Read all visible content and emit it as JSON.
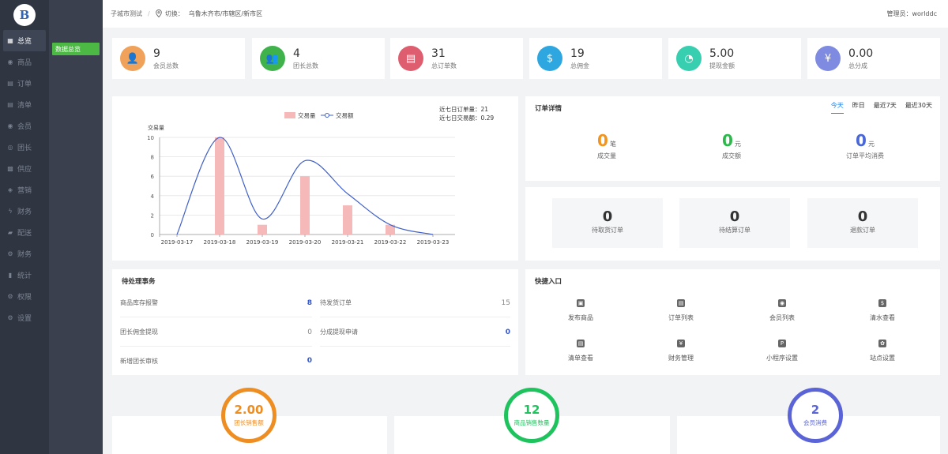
{
  "logo": {
    "letter": "B"
  },
  "sidebar": {
    "items": [
      {
        "label": "总览",
        "icon": "grid-icon",
        "glyph": "▦",
        "active": true
      },
      {
        "label": "商品",
        "icon": "box-icon",
        "glyph": "◉"
      },
      {
        "label": "订单",
        "icon": "document-icon",
        "glyph": "▤"
      },
      {
        "label": "清单",
        "icon": "list-icon",
        "glyph": "▤"
      },
      {
        "label": "会员",
        "icon": "user-icon",
        "glyph": "◉"
      },
      {
        "label": "团长",
        "icon": "group-icon",
        "glyph": "◎"
      },
      {
        "label": "供应",
        "icon": "truck-icon",
        "glyph": "▩"
      },
      {
        "label": "营销",
        "icon": "megaphone-icon",
        "glyph": "◈"
      },
      {
        "label": "财务",
        "icon": "lightning-icon",
        "glyph": "ϟ"
      },
      {
        "label": "配送",
        "icon": "delivery-icon",
        "glyph": "▰"
      },
      {
        "label": "财务",
        "icon": "wallet-icon",
        "glyph": "⚙"
      },
      {
        "label": "统计",
        "icon": "chart-icon",
        "glyph": "▮"
      },
      {
        "label": "权限",
        "icon": "key-icon",
        "glyph": "⚙"
      },
      {
        "label": "设置",
        "icon": "settings-icon",
        "glyph": "⚙"
      }
    ]
  },
  "subnav": {
    "active": "数据总览"
  },
  "topbar": {
    "breadcrumb": "子城市测试",
    "separator": "/",
    "switch_label": "切换：",
    "location": "乌鲁木齐市/市辖区/新市区",
    "admin_label": "管理员：",
    "admin_name": "worlddc"
  },
  "stats": [
    {
      "value": "9",
      "label": "会员总数",
      "color": "#f0a25a",
      "icon": "member-icon",
      "glyph": "👤"
    },
    {
      "value": "4",
      "label": "团长总数",
      "color": "#3fb24c",
      "icon": "leader-icon",
      "glyph": "👥"
    },
    {
      "value": "31",
      "label": "总订单数",
      "color": "#de5e6f",
      "icon": "order-icon",
      "glyph": "▤"
    },
    {
      "value": "19",
      "label": "总佣金",
      "color": "#2ea7e0",
      "icon": "moneybag-icon",
      "glyph": "$"
    },
    {
      "value": "5.00",
      "label": "提现金额",
      "color": "#38cfb0",
      "icon": "pie-icon",
      "glyph": "◔"
    },
    {
      "value": "0.00",
      "label": "总分成",
      "color": "#7e8be0",
      "icon": "shield-yen-icon",
      "glyph": "¥"
    }
  ],
  "chart_data": {
    "type": "bar",
    "categories": [
      "2019-03-17",
      "2019-03-18",
      "2019-03-19",
      "2019-03-20",
      "2019-03-21",
      "2019-03-22",
      "2019-03-23"
    ],
    "series": [
      {
        "name": "交易量",
        "type": "bar",
        "color": "#f6b9b9",
        "values": [
          0,
          10,
          1,
          6,
          3,
          1,
          0
        ]
      },
      {
        "name": "交易额",
        "type": "line",
        "color": "#4060c8",
        "values": [
          0,
          10,
          1.6,
          7.6,
          4.2,
          1.0,
          0
        ]
      }
    ],
    "ylabel": "交易量",
    "ylim": [
      0,
      10
    ],
    "yticks": [
      0,
      2,
      4,
      6,
      8,
      10
    ],
    "grid": true,
    "legend": "top-center",
    "summary": [
      {
        "label": "近七日订单量：",
        "value": "21"
      },
      {
        "label": "近七日交易额：",
        "value": "0.29"
      }
    ]
  },
  "order_detail": {
    "title": "订单详情",
    "tabs": [
      "今天",
      "昨日",
      "最近7天",
      "最近30天"
    ],
    "active_tab": "今天",
    "metrics": [
      {
        "value": "0",
        "unit": "笔",
        "label": "成交量",
        "color": "#f0951f"
      },
      {
        "value": "0",
        "unit": "元",
        "label": "成交额",
        "color": "#2cb84a"
      },
      {
        "value": "0",
        "unit": "元",
        "label": "订单平均消费",
        "color": "#4a67d8"
      }
    ]
  },
  "pending_orders": [
    {
      "value": "0",
      "label": "待取货订单"
    },
    {
      "value": "0",
      "label": "待结算订单"
    },
    {
      "value": "0",
      "label": "退款订单"
    }
  ],
  "todo": {
    "title": "待处理事务",
    "rows": [
      {
        "label": "商品库存报警",
        "value": "8",
        "style": "blue"
      },
      {
        "label": "待发货订单",
        "value": "15",
        "style": "grey"
      },
      {
        "label": "团长佣金提现",
        "value": "0",
        "style": "grey"
      },
      {
        "label": "分成提现申请",
        "value": "0",
        "style": "blue"
      },
      {
        "label": "新增团长审核",
        "value": "0",
        "style": "blue"
      }
    ]
  },
  "quick": {
    "title": "快捷入口",
    "items": [
      {
        "label": "发布商品",
        "icon": "publish-icon",
        "glyph": "▣"
      },
      {
        "label": "订单列表",
        "icon": "order-list-icon",
        "glyph": "▤"
      },
      {
        "label": "会员列表",
        "icon": "member-list-icon",
        "glyph": "◉"
      },
      {
        "label": "清水查看",
        "icon": "moneybag-icon",
        "glyph": "$"
      },
      {
        "label": "清单查看",
        "icon": "checklist-icon",
        "glyph": "▤"
      },
      {
        "label": "财务管理",
        "icon": "yen-icon",
        "glyph": "¥"
      },
      {
        "label": "小程序设置",
        "icon": "miniapp-icon",
        "glyph": "P"
      },
      {
        "label": "站点设置",
        "icon": "site-settings-icon",
        "glyph": "✿"
      }
    ]
  },
  "rings": [
    {
      "value": "2.00",
      "label": "团长销售额",
      "color": "#ee8d22"
    },
    {
      "value": "12",
      "label": "商品销售数量",
      "color": "#1fc35e"
    },
    {
      "value": "2",
      "label": "会员消费",
      "color": "#5a64d6"
    }
  ]
}
